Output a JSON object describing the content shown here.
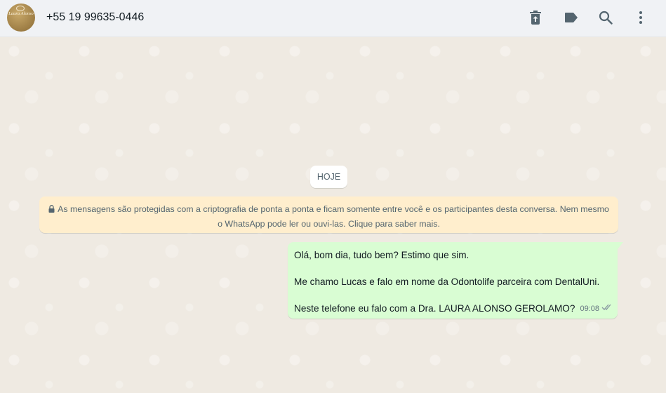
{
  "header": {
    "avatar_text": "Laura Alonso",
    "contact": "+55 19 99635-0446",
    "icons": [
      "delete-icon",
      "label-icon",
      "search-icon",
      "menu-dots-icon"
    ]
  },
  "chat": {
    "date_chip": "HOJE",
    "encryption_notice": "As mensagens são protegidas com a criptografia de ponta a ponta e ficam somente entre você e os participantes desta conversa. Nem mesmo o WhatsApp pode ler ou ouvi-las. Clique para saber mais.",
    "messages": [
      {
        "direction": "outgoing",
        "lines": [
          "Olá, bom dia, tudo bem? Estimo que sim.",
          "Me chamo Lucas e falo em nome da Odontolife parceira com DentalUni.",
          "Neste telefone eu falo com a Dra. LAURA ALONSO GEROLAMO?"
        ],
        "time": "09:08",
        "status": "read"
      }
    ]
  },
  "colors": {
    "background": "#efeae2",
    "outgoing_bubble": "#d9fdd3",
    "notice_bg": "#ffeecd",
    "icon": "#54656f",
    "read_ticks": "#8696a0"
  }
}
